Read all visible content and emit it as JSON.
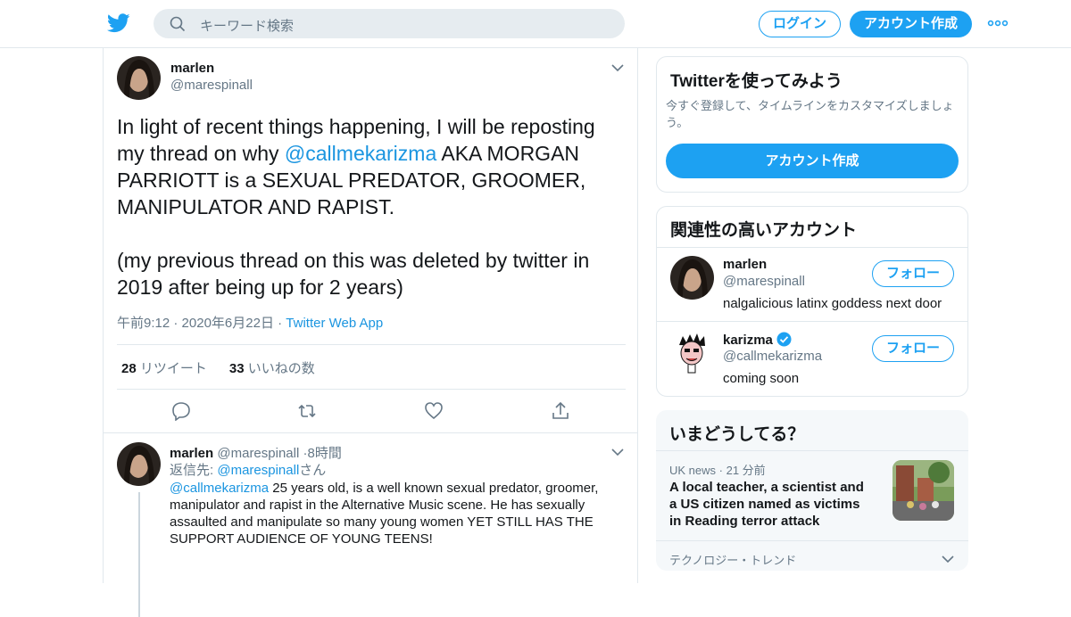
{
  "header": {
    "search_placeholder": "キーワード検索",
    "login_label": "ログイン",
    "signup_label": "アカウント作成"
  },
  "tweet": {
    "author_name": "marlen",
    "author_handle": "@marespinall",
    "text_part1": "In light of recent things happening, I will be reposting my thread on why ",
    "mention": "@callmekarizma",
    "text_part2": " AKA MORGAN PARRIOTT is a SEXUAL PREDATOR, GROOMER, MANIPULATOR AND RAPIST.\n\n(my previous thread on this was deleted by twitter in 2019 after being up for 2 years)",
    "time": "午前9:12",
    "date": "2020年6月22日",
    "app": "Twitter Web App",
    "retweets": "28",
    "retweets_label": "リツイート",
    "likes": "33",
    "likes_label": "いいねの数"
  },
  "reply": {
    "author_name": "marlen",
    "author_handle": "@marespinall",
    "age": "8時間",
    "reply_to_prefix": "返信先: ",
    "reply_to_handle": "@marespinall",
    "reply_to_suffix": "さん",
    "mention": "@callmekarizma",
    "text": " 25 years old, is a well known sexual predator, groomer, manipulator and rapist in the Alternative Music scene. He has sexually assaulted and manipulate so many young women YET STILL HAS THE SUPPORT AUDIENCE OF YOUNG TEENS!"
  },
  "signup_card": {
    "title": "Twitterを使ってみよう",
    "description": "今すぐ登録して、タイムラインをカスタマイズしましょう。",
    "button": "アカウント作成"
  },
  "related_card": {
    "title": "関連性の高いアカウント",
    "accounts": [
      {
        "name": "marlen",
        "handle": "@marespinall",
        "bio": "nalgalicious latinx goddess next door",
        "follow": "フォロー",
        "verified": false
      },
      {
        "name": "karizma",
        "handle": "@callmekarizma",
        "bio": "coming soon",
        "follow": "フォロー",
        "verified": true
      }
    ]
  },
  "trends_card": {
    "title": "いまどうしてる？",
    "items": [
      {
        "source": "UK news",
        "age": "21 分前",
        "headline": "A local teacher, a scientist and a US citizen named as victims in Reading terror attack"
      },
      {
        "source": "テクノロジー・トレンド"
      }
    ]
  },
  "colors": {
    "accent": "#1da1f2",
    "link": "#1b95e0",
    "muted": "#657786",
    "border": "#e1e8ed"
  }
}
